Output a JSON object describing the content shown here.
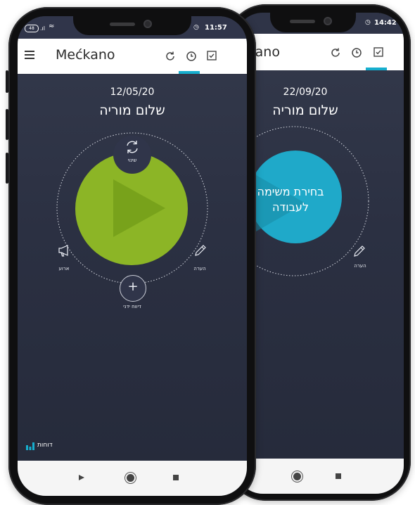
{
  "back_phone": {
    "status_time": "14:42",
    "app_title": "kano",
    "date": "22/09/20",
    "greeting": "שלום מוריה",
    "task_button_label": "בחירת משימה לעבודה",
    "note_label": "הערה"
  },
  "front_phone": {
    "status_time": "11:57",
    "app_title": "Mećkano",
    "date": "12/05/20",
    "greeting": "שלום מוריה",
    "change_label": "שינוי",
    "event_label": "ארוע",
    "note_label": "הערה",
    "manual_report_label": "דיווח ידני",
    "reports_label": "דוחות"
  },
  "colors": {
    "accent": "#16aece",
    "play_green": "#8cb526",
    "task_blue": "#1fa9c9",
    "screen_bg": "#2b3042"
  }
}
